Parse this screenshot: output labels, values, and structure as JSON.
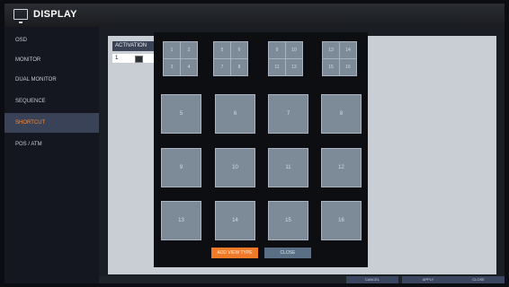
{
  "window": {
    "title": "DISPLAY",
    "icon": "monitor-icon"
  },
  "sidebar": {
    "items": [
      {
        "label": "OSD",
        "active": false
      },
      {
        "label": "MONITOR",
        "active": false
      },
      {
        "label": "DUAL MONITOR",
        "active": false
      },
      {
        "label": "SEQUENCE",
        "active": false
      },
      {
        "label": "SHORTCUT",
        "active": true
      },
      {
        "label": "POS / ATM",
        "active": false
      }
    ]
  },
  "activation_table": {
    "header": "ACTIVATION",
    "row_number": "1"
  },
  "view_type_popup": {
    "quad_layouts": [
      [
        "1",
        "2",
        "3",
        "4"
      ],
      [
        "5",
        "6",
        "7",
        "8"
      ],
      [
        "9",
        "10",
        "11",
        "12"
      ],
      [
        "13",
        "14",
        "15",
        "16"
      ]
    ],
    "single_cells": [
      "5",
      "6",
      "7",
      "8",
      "9",
      "10",
      "11",
      "12",
      "13",
      "14",
      "15",
      "16"
    ],
    "add_button": "ADD VIEW TYPE",
    "close_button": "CLOSE"
  },
  "footer": {
    "buttons": [
      "CANCEL",
      "APPLY",
      "CLOSE"
    ]
  },
  "colors": {
    "accent": "#f07a28",
    "active_sidebar_bg": "#3a4258",
    "cell_fill": "#7d8a98"
  }
}
